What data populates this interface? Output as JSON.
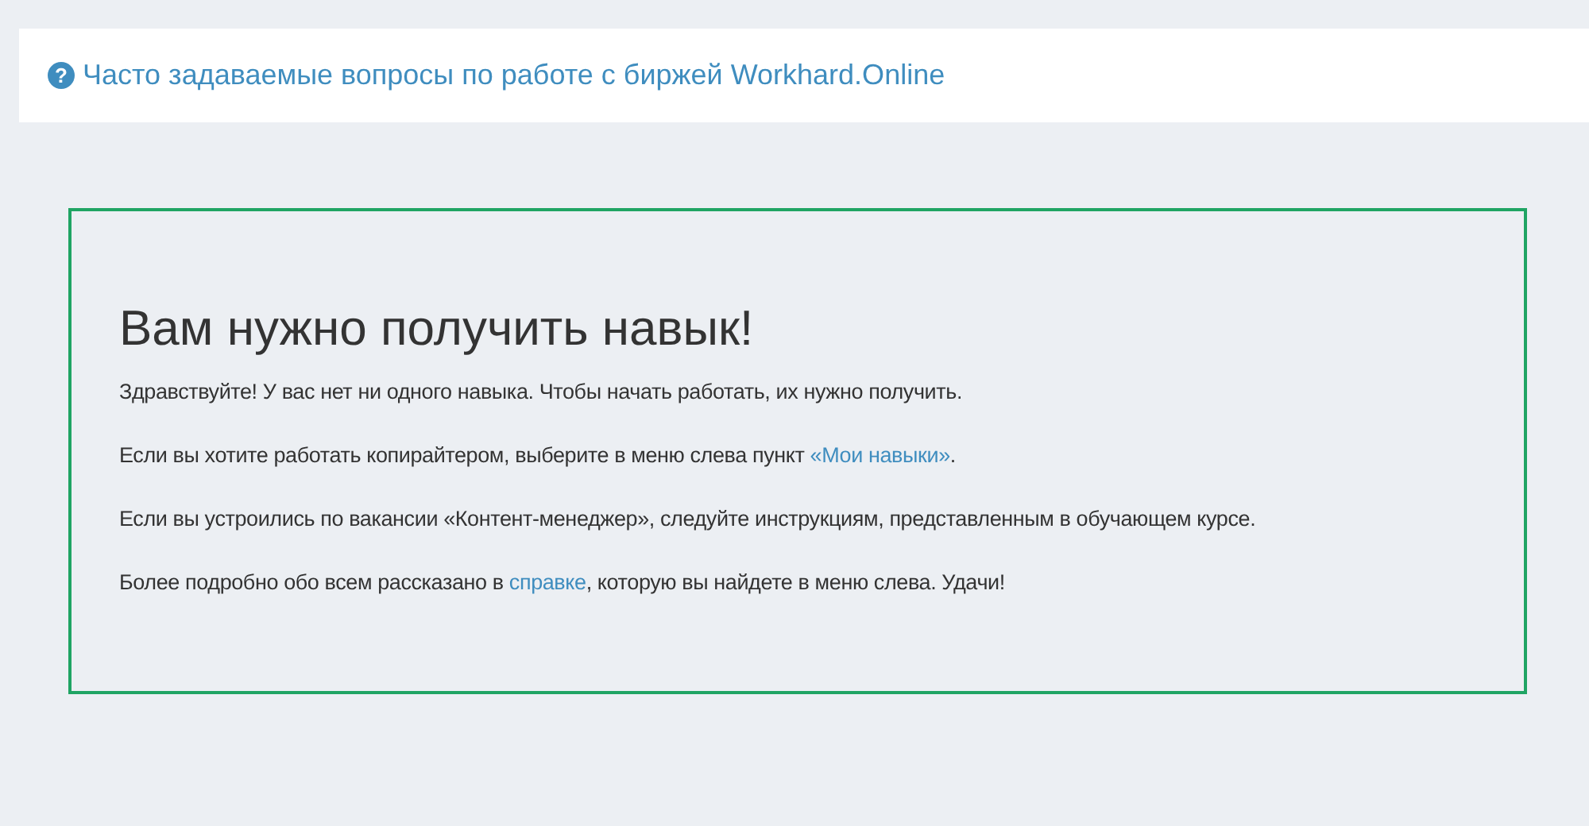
{
  "faq_link": {
    "icon": "?",
    "label": "Часто задаваемые вопросы по работе с биржей Workhard.Online"
  },
  "notice": {
    "title": "Вам нужно получить навык!",
    "paragraphs": [
      {
        "text": "Здравствуйте! У вас нет ни одного навыка. Чтобы начать работать, их нужно получить."
      },
      {
        "text": "Если вы хотите работать копирайтером, выберите в меню слева пункт ",
        "link": "«Мои навыки»",
        "after": "."
      },
      {
        "text": "Если вы устроились по вакансии «Контент-менеджер», следуйте инструкциям, представленным в обучающем курсе."
      },
      {
        "text": "Более подробно обо всем рассказано в ",
        "link": "справке",
        "after": ", которую вы найдете в меню слева. Удачи!"
      }
    ]
  }
}
